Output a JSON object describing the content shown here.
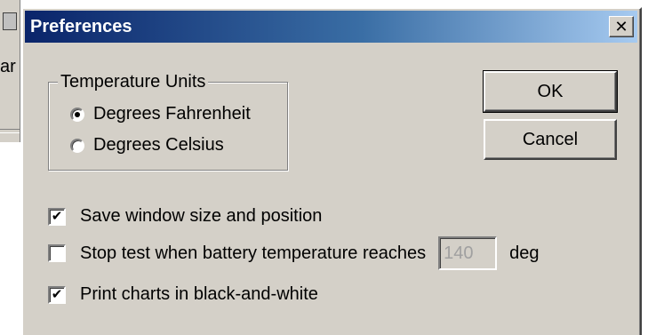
{
  "background_app": {
    "fragment_text": "ar"
  },
  "dialog": {
    "title": "Preferences",
    "close_glyph": "✕"
  },
  "temperature_units": {
    "legend": "Temperature Units",
    "options": [
      {
        "label": "Degrees Fahrenheit",
        "selected": true
      },
      {
        "label": "Degrees Celsius",
        "selected": false
      }
    ]
  },
  "buttons": {
    "ok_label": "OK",
    "cancel_label": "Cancel"
  },
  "options": {
    "save_window": {
      "label": "Save window size and position",
      "checked": true
    },
    "stop_test": {
      "label": "Stop test when battery temperature reaches",
      "checked": false,
      "value": "140",
      "unit": "deg"
    },
    "print_bw": {
      "label": "Print charts in black-and-white",
      "checked": true
    }
  },
  "check_glyph": "✔",
  "colors": {
    "dialog_face": "#d4d0c8",
    "title_start": "#0a246a",
    "title_end": "#a6caf0"
  }
}
